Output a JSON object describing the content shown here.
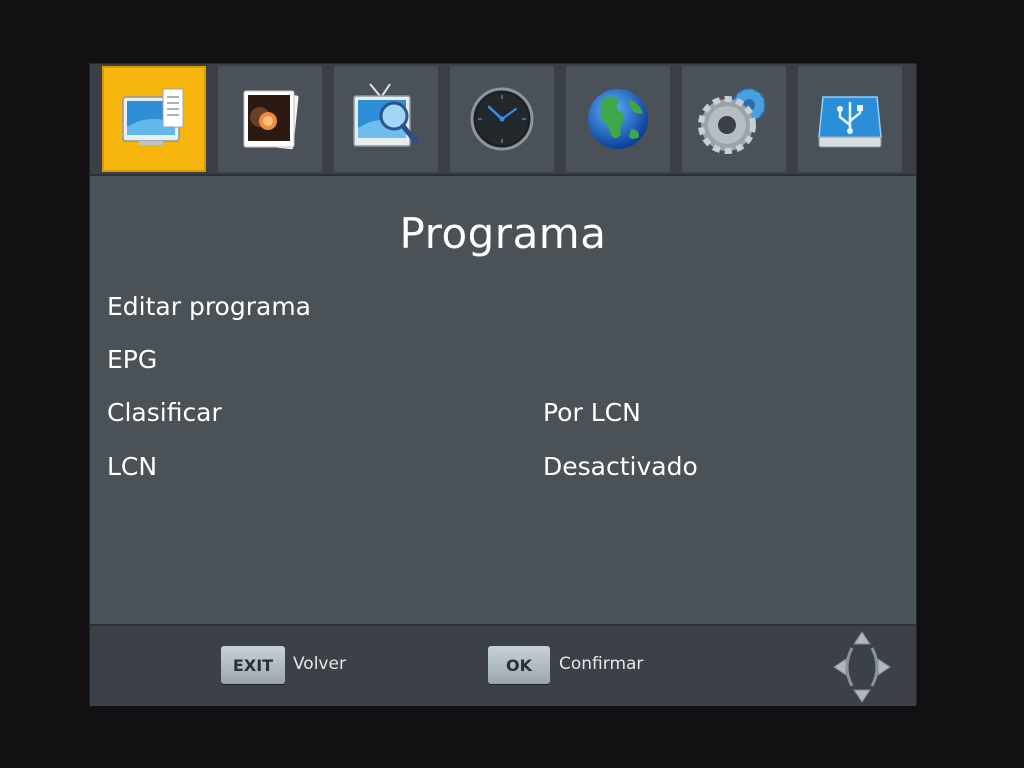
{
  "menu": {
    "tabs": [
      {
        "name": "program-icon",
        "selected": true
      },
      {
        "name": "media-icon",
        "selected": false
      },
      {
        "name": "search-icon",
        "selected": false
      },
      {
        "name": "clock-icon",
        "selected": false
      },
      {
        "name": "globe-icon",
        "selected": false
      },
      {
        "name": "gear-icon",
        "selected": false
      },
      {
        "name": "usb-icon",
        "selected": false
      }
    ]
  },
  "page": {
    "title": "Programa"
  },
  "items": [
    {
      "label": "Editar programa",
      "value": ""
    },
    {
      "label": "EPG",
      "value": ""
    },
    {
      "label": "Clasificar",
      "value": "Por LCN"
    },
    {
      "label": "LCN",
      "value": "Desactivado"
    }
  ],
  "footer": {
    "exit_key": "EXIT",
    "exit_label": "Volver",
    "ok_key": "OK",
    "ok_label": "Confirmar"
  },
  "colors": {
    "selected_tab": "#f5b50c",
    "panel": "#4a5157",
    "text": "#ffffff"
  }
}
